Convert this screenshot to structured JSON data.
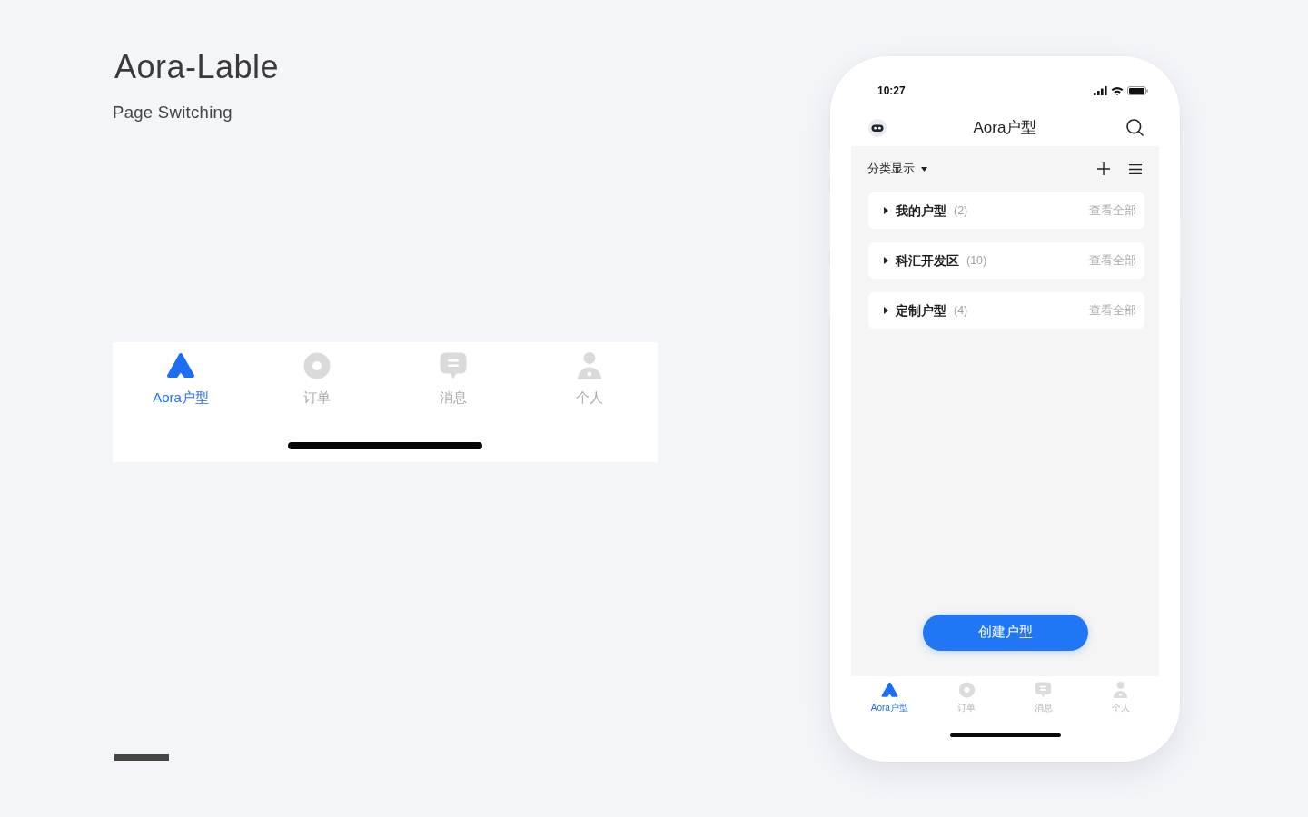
{
  "header": {
    "title": "Aora-Lable",
    "subtitle": "Page Switching"
  },
  "tab_bar_preview": {
    "tabs": [
      {
        "label": "Aora户型",
        "selected": true
      },
      {
        "label": "订单",
        "selected": false
      },
      {
        "label": "消息",
        "selected": false
      },
      {
        "label": "个人",
        "selected": false
      }
    ]
  },
  "phone": {
    "status_bar": {
      "time": "10:27"
    },
    "nav_bar": {
      "title": "Aora户型"
    },
    "toolbar": {
      "filter": "分类显示"
    },
    "groups": [
      {
        "name": "我的户型",
        "count": "(2)",
        "action": "查看全部",
        "expanded": false
      },
      {
        "name": "科汇开发区",
        "count": "(10)",
        "action": "查看全部",
        "expanded": false
      },
      {
        "name": "定制户型",
        "count": "(4)",
        "action": "查看全部",
        "expanded": false
      }
    ],
    "create_button": "创建户型",
    "tab_bar": {
      "tabs": [
        {
          "label": "Aora户型",
          "selected": true
        },
        {
          "label": "订单",
          "selected": false
        },
        {
          "label": "消息",
          "selected": false
        },
        {
          "label": "个人",
          "selected": false
        }
      ]
    }
  }
}
